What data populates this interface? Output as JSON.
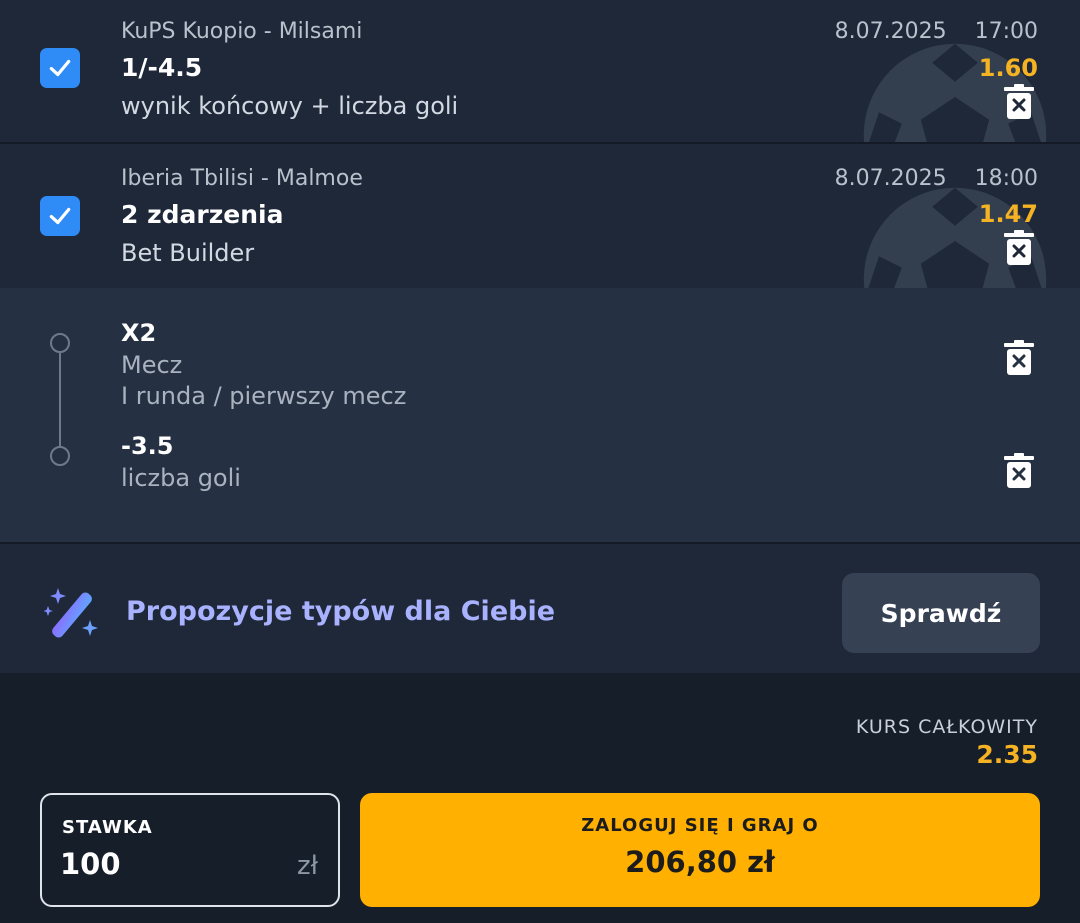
{
  "bets": [
    {
      "teams": "KuPS Kuopio - Milsami",
      "date": "8.07.2025",
      "time": "17:00",
      "pick": "1/-4.5",
      "odds": "1.60",
      "market": "wynik końcowy + liczba goli",
      "checked": true
    },
    {
      "teams": "Iberia Tbilisi - Malmoe",
      "date": "8.07.2025",
      "time": "18:00",
      "pick": "2 zdarzenia",
      "odds": "1.47",
      "market": "Bet Builder",
      "checked": true
    }
  ],
  "builder_legs": [
    {
      "pick": "X2",
      "line1": "Mecz",
      "line2": "I runda / pierwszy mecz"
    },
    {
      "pick": "-3.5",
      "line1": "liczba goli"
    }
  ],
  "suggestions": {
    "text": "Propozycje typów dla Ciebie",
    "button": "Sprawdź"
  },
  "summary": {
    "total_odds_label": "KURS CAŁKOWITY",
    "total_odds": "2.35",
    "stake_label": "STAWKA",
    "stake_value": "100",
    "currency": "zł",
    "play_label": "ZALOGUJ SIĘ I GRAJ O",
    "play_amount": "206,80 zł"
  },
  "colors": {
    "accent": "#ffb000",
    "odds": "#f5b323",
    "checkbox": "#2f8bf5",
    "suggestion_text": "#a9b2ff"
  }
}
